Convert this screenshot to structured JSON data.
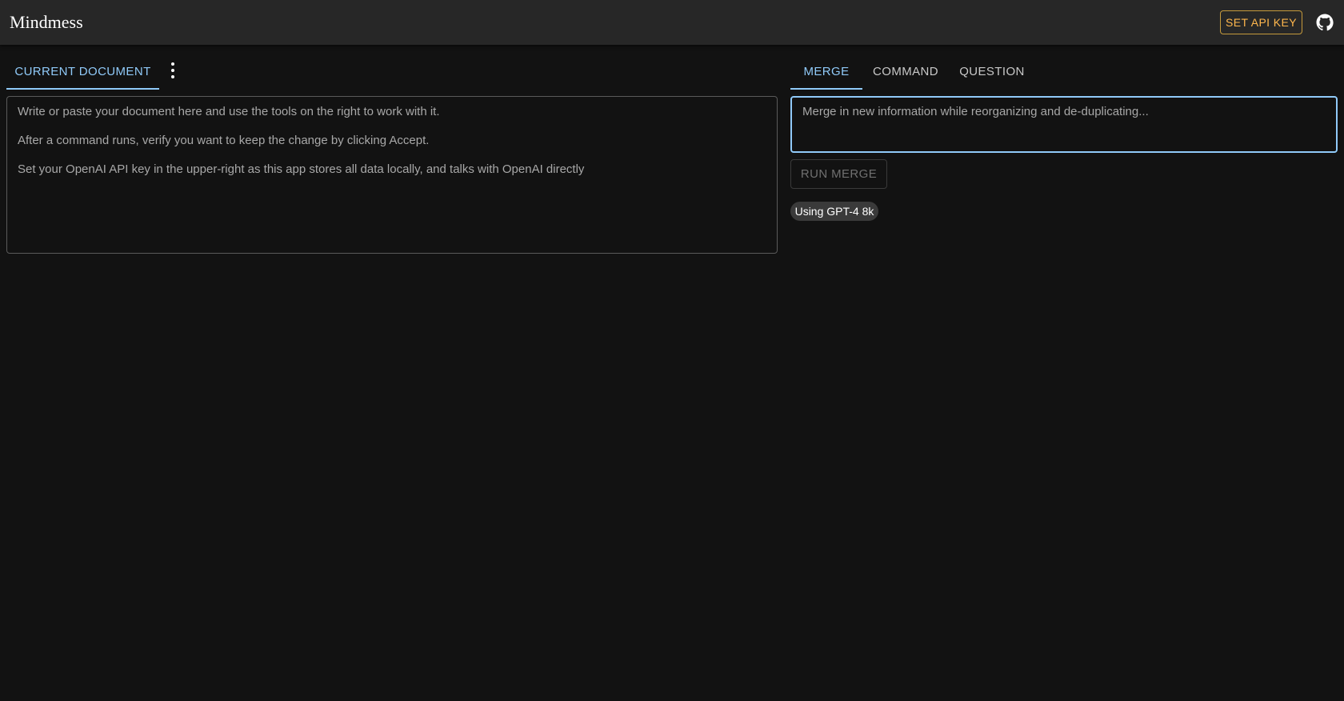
{
  "app": {
    "title": "Mindmess"
  },
  "header": {
    "api_key_label": "SET API KEY",
    "github_icon": "github-icon"
  },
  "left_tabs": [
    {
      "label": "CURRENT DOCUMENT",
      "active": true
    }
  ],
  "more_icon": "more-vert-icon",
  "document": {
    "lines": [
      "Write or paste your document here and use the tools on the right to work with it.",
      "After a command runs, verify you want to keep the change by clicking Accept.",
      "Set your OpenAI API key in the upper-right as this app stores all data locally, and talks with OpenAI directly"
    ]
  },
  "right_tabs": [
    {
      "label": "MERGE",
      "active": true
    },
    {
      "label": "COMMAND",
      "active": false
    },
    {
      "label": "QUESTION",
      "active": false
    }
  ],
  "merge": {
    "placeholder": "Merge in new information while reorganizing and de-duplicating...",
    "run_label": "RUN MERGE",
    "model_chip": "Using GPT-4 8k"
  },
  "colors": {
    "accent": "#90caf9",
    "warning": "#ffb74d",
    "background": "#121212",
    "appbar": "#272727"
  }
}
